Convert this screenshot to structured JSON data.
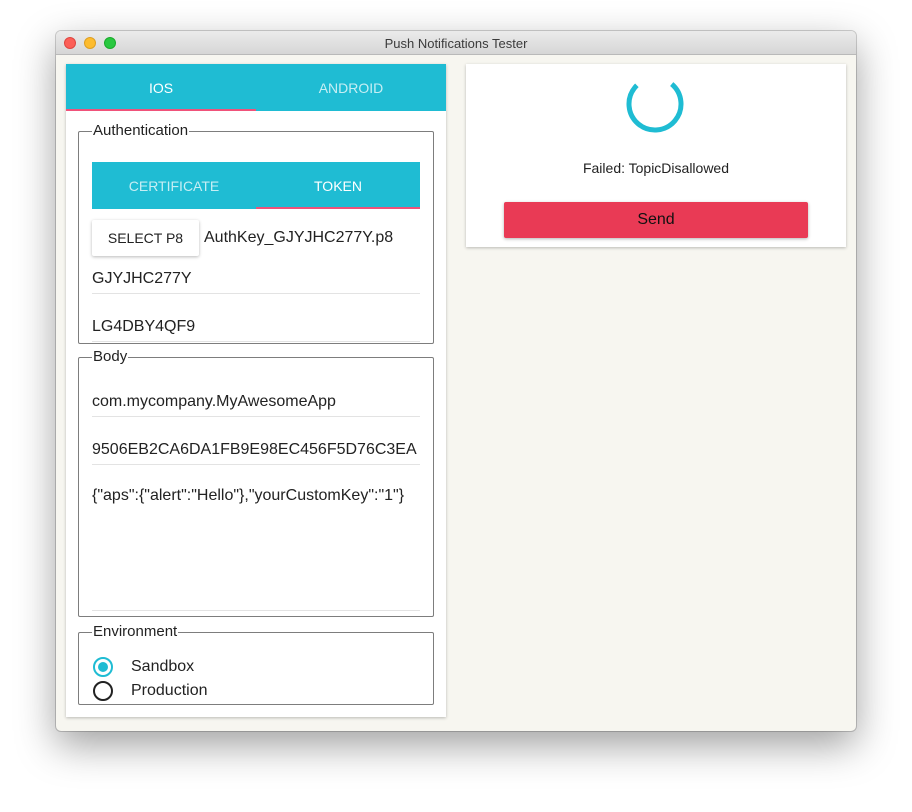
{
  "window": {
    "title": "Push Notifications Tester"
  },
  "platform_tabs": {
    "ios": "IOS",
    "android": "ANDROID",
    "active": "ios"
  },
  "authentication": {
    "legend": "Authentication",
    "tabs": {
      "certificate": "CERTIFICATE",
      "token": "TOKEN",
      "active": "token"
    },
    "select_button": "SELECT P8",
    "file_name": "AuthKey_GJYJHC277Y.p8",
    "key_id": "GJYJHC277Y",
    "team_id": "LG4DBY4QF9"
  },
  "body": {
    "legend": "Body",
    "bundle_id": "com.mycompany.MyAwesomeApp",
    "device_token": "9506EB2CA6DA1FB9E98EC456F5D76C3EA",
    "payload": "{\"aps\":{\"alert\":\"Hello\"},\"yourCustomKey\":\"1\"}"
  },
  "environment": {
    "legend": "Environment",
    "options": [
      "Sandbox",
      "Production"
    ],
    "selected": "Sandbox"
  },
  "status": {
    "message": "Failed: TopicDisallowed",
    "send_label": "Send"
  },
  "colors": {
    "accent": "#1fbcd3",
    "tab_indicator": "#f0527a",
    "send_button": "#e93a55"
  }
}
